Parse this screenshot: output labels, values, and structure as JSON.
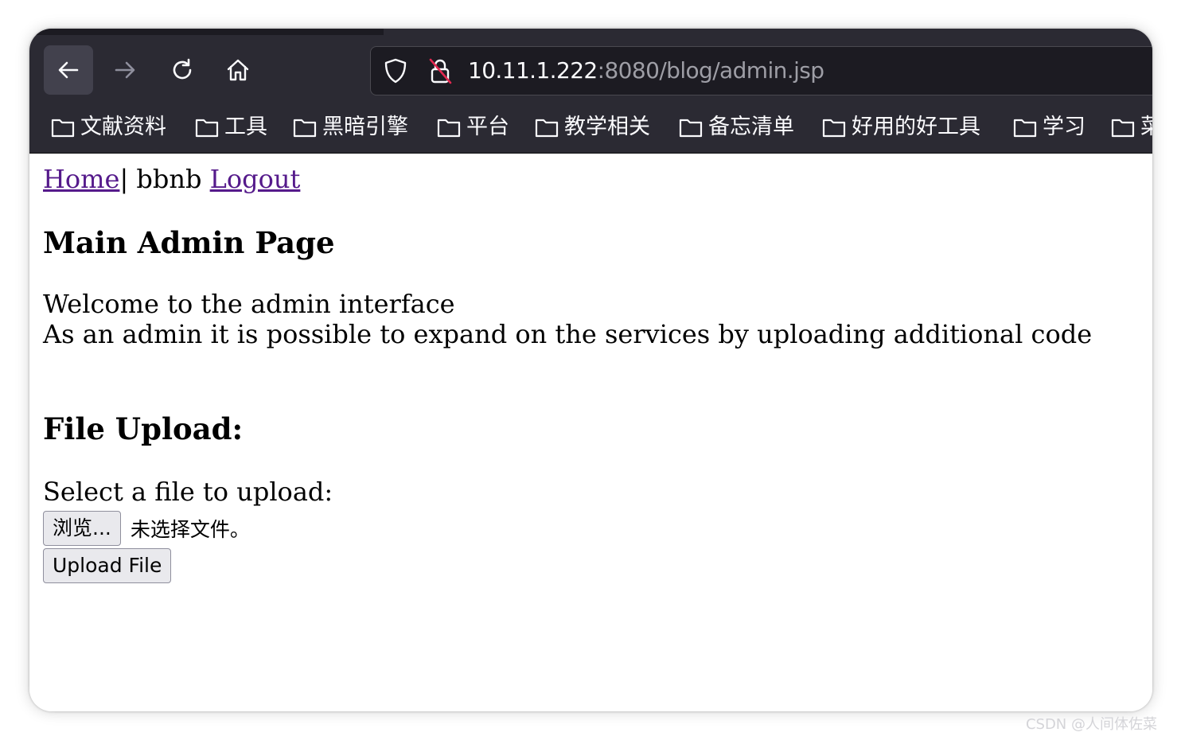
{
  "browser": {
    "url_host": "10.11.1.222",
    "url_rest": ":8080/blog/admin.jsp",
    "bookmarks": [
      "文献资料",
      "工具",
      "黑暗引擎",
      "平台",
      "教学相关",
      "备忘清单",
      "好用的好工具",
      "学习",
      "菜"
    ]
  },
  "page": {
    "nav": {
      "home": "Home",
      "separator": "| bbnb ",
      "logout": "Logout"
    },
    "title": "Main Admin Page",
    "welcome": "Welcome to the admin interface",
    "description": "As an admin it is possible to expand on the services by uploading additional code",
    "upload_heading": "File Upload:",
    "select_label": "Select a file to upload:",
    "browse_button": "浏览...",
    "file_status": "未选择文件。",
    "upload_button": "Upload File"
  },
  "watermark": "CSDN @人间体佐菜",
  "colors": {
    "chrome": "#2b2a33",
    "link_visited": "#551a8b"
  }
}
